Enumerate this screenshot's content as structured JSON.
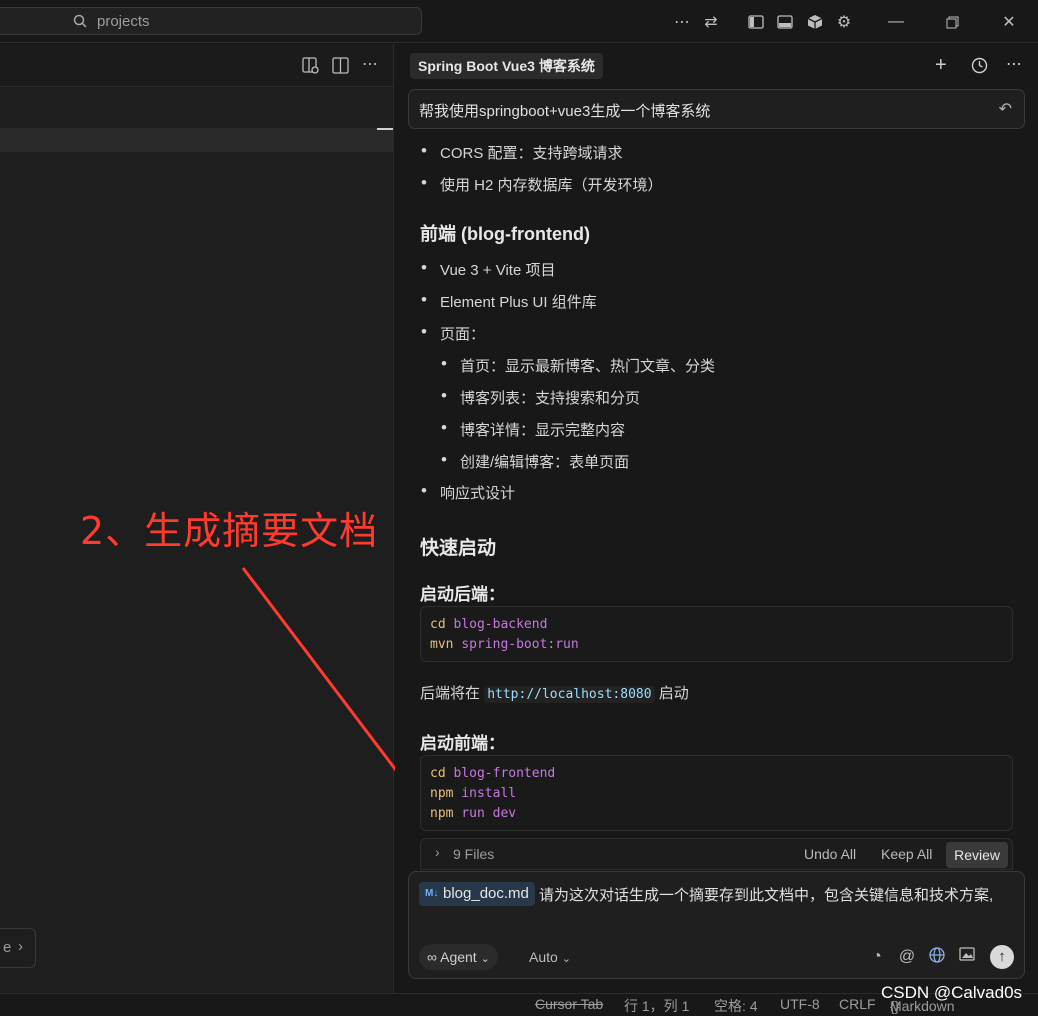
{
  "titlebar": {
    "search_placeholder": "projects",
    "icons": [
      "search-icon",
      "more-icon",
      "swap-icon",
      "sidebar-toggle-icon",
      "panel-toggle-icon",
      "cube-icon",
      "gear-icon",
      "minimize-icon",
      "restore-icon",
      "close-icon"
    ]
  },
  "editor": {
    "chip_text": "e"
  },
  "annotation": {
    "text": "2、生成摘要文档",
    "color": "#ff3b30"
  },
  "chat": {
    "title": "Spring Boot Vue3 博客系统",
    "user_prompt": "帮我使用springboot+vue3生成一个博客系统",
    "items": {
      "cors": "CORS 配置：支持跨域请求",
      "h2": "使用 H2 内存数据库（开发环境）",
      "frontend_heading": "前端 (blog-frontend)",
      "vue": "Vue 3 + Vite 项目",
      "element": "Element Plus UI 组件库",
      "pages": "页面：",
      "page_home": "首页：显示最新博客、热门文章、分类",
      "page_list": "博客列表：支持搜索和分页",
      "page_detail": "博客详情：显示完整内容",
      "page_edit": "创建/编辑博客：表单页面",
      "responsive": "响应式设计",
      "quickstart_heading": "快速启动",
      "backend_heading": "启动后端：",
      "backend_code": {
        "l1_cmd": "cd",
        "l1_arg": "blog-backend",
        "l2_cmd": "mvn",
        "l2_arg": "spring-boot:run"
      },
      "backend_note_pre": "后端将在",
      "backend_note_url": "http://localhost:8080",
      "backend_note_post": "启动",
      "frontend_start_heading": "启动前端：",
      "frontend_code": {
        "l1_cmd": "cd",
        "l1_arg": "blog-frontend",
        "l2_cmd": "npm",
        "l2_arg": "install",
        "l3_cmd": "npm",
        "l3_arg": "run dev"
      }
    },
    "files_bar": {
      "files_label": "9 Files",
      "undo_all": "Undo All",
      "keep_all": "Keep All",
      "review": "Review"
    },
    "input": {
      "file_chip": "blog_doc.md",
      "text": "请为这次对话生成一个摘要存到此文档中，包含关键信息和技术方案,",
      "agent_label": "Agent",
      "auto_label": "Auto"
    }
  },
  "statusbar": {
    "cursor_tab": "Cursor Tab",
    "position": "行 1，列 1",
    "spaces": "空格: 4",
    "encoding": "UTF-8",
    "eol": "CRLF",
    "language": "Markdown"
  },
  "watermark": "CSDN @Calvad0s"
}
